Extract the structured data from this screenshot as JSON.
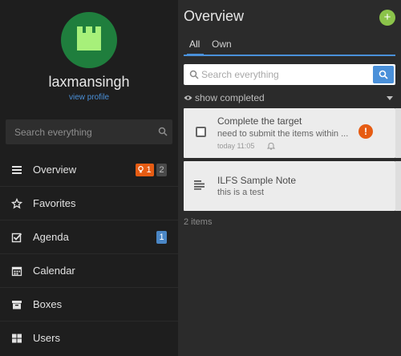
{
  "profile": {
    "username": "laxmansingh",
    "view_profile": "view profile"
  },
  "sidebar": {
    "search_placeholder": "Search everything",
    "items": [
      {
        "label": "Overview",
        "icon": "list-icon",
        "badges": [
          "1",
          "2"
        ]
      },
      {
        "label": "Favorites",
        "icon": "star-icon"
      },
      {
        "label": "Agenda",
        "icon": "checkbox-icon",
        "badges": [
          "1"
        ]
      },
      {
        "label": "Calendar",
        "icon": "calendar-icon"
      },
      {
        "label": "Boxes",
        "icon": "box-icon"
      },
      {
        "label": "Users",
        "icon": "grid-icon"
      }
    ]
  },
  "main": {
    "title": "Overview",
    "add_label": "+",
    "tabs": [
      "All",
      "Own"
    ],
    "search_placeholder": "Search everything",
    "show_completed": "show completed",
    "cards": [
      {
        "title": "Complete the target",
        "description": "need to submit the items within ...",
        "time": "today 11:05",
        "alert": "!"
      },
      {
        "title": "ILFS Sample Note",
        "description": "this is a test"
      }
    ],
    "count": "2 items"
  },
  "colors": {
    "accent": "#4a90d9",
    "warning": "#e65c13",
    "add": "#8bc34a",
    "avatar": "#1f7e3d"
  }
}
